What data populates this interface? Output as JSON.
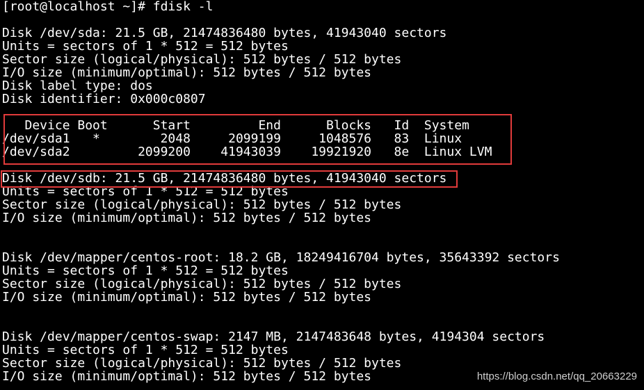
{
  "terminal": {
    "lines": [
      "[root@localhost ~]# fdisk -l",
      "",
      "Disk /dev/sda: 21.5 GB, 21474836480 bytes, 41943040 sectors",
      "Units = sectors of 1 * 512 = 512 bytes",
      "Sector size (logical/physical): 512 bytes / 512 bytes",
      "I/O size (minimum/optimal): 512 bytes / 512 bytes",
      "Disk label type: dos",
      "Disk identifier: 0x000c0807",
      "",
      "   Device Boot      Start         End      Blocks   Id  System",
      "/dev/sda1   *        2048     2099199     1048576   83  Linux",
      "/dev/sda2         2099200    41943039    19921920   8e  Linux LVM",
      "",
      "Disk /dev/sdb: 21.5 GB, 21474836480 bytes, 41943040 sectors",
      "Units = sectors of 1 * 512 = 512 bytes",
      "Sector size (logical/physical): 512 bytes / 512 bytes",
      "I/O size (minimum/optimal): 512 bytes / 512 bytes",
      "",
      "",
      "Disk /dev/mapper/centos-root: 18.2 GB, 18249416704 bytes, 35643392 sectors",
      "Units = sectors of 1 * 512 = 512 bytes",
      "Sector size (logical/physical): 512 bytes / 512 bytes",
      "I/O size (minimum/optimal): 512 bytes / 512 bytes",
      "",
      "",
      "Disk /dev/mapper/centos-swap: 2147 MB, 2147483648 bytes, 4194304 sectors",
      "Units = sectors of 1 * 512 = 512 bytes",
      "Sector size (logical/physical): 512 bytes / 512 bytes",
      "I/O size (minimum/optimal): 512 bytes / 512 bytes"
    ]
  },
  "watermark": "https://blog.csdn.net/qq_20663229",
  "colors": {
    "background": "#000000",
    "text": "#ffffff",
    "highlight": "#e23b3b"
  }
}
